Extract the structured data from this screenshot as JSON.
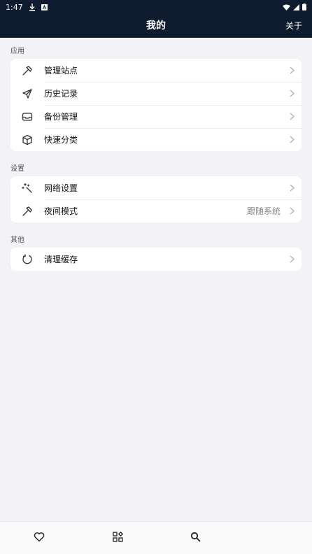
{
  "status_bar": {
    "time": "1:47"
  },
  "app_bar": {
    "title": "我的",
    "action": "关于"
  },
  "sections": [
    {
      "title": "应用",
      "items": [
        {
          "label": "管理站点",
          "icon": "hammer-icon"
        },
        {
          "label": "历史记录",
          "icon": "send-icon"
        },
        {
          "label": "备份管理",
          "icon": "inbox-icon"
        },
        {
          "label": "快速分类",
          "icon": "cube-icon"
        }
      ]
    },
    {
      "title": "设置",
      "items": [
        {
          "label": "网络设置",
          "icon": "magic-wand-icon"
        },
        {
          "label": "夜间模式",
          "icon": "hammer-icon",
          "value": "跟随系统"
        }
      ]
    },
    {
      "title": "其他",
      "items": [
        {
          "label": "清理缓存",
          "icon": "refresh-icon"
        }
      ]
    }
  ],
  "bottom_nav": [
    {
      "icon": "heart-icon"
    },
    {
      "icon": "grid-icon"
    },
    {
      "icon": "search-icon"
    }
  ]
}
